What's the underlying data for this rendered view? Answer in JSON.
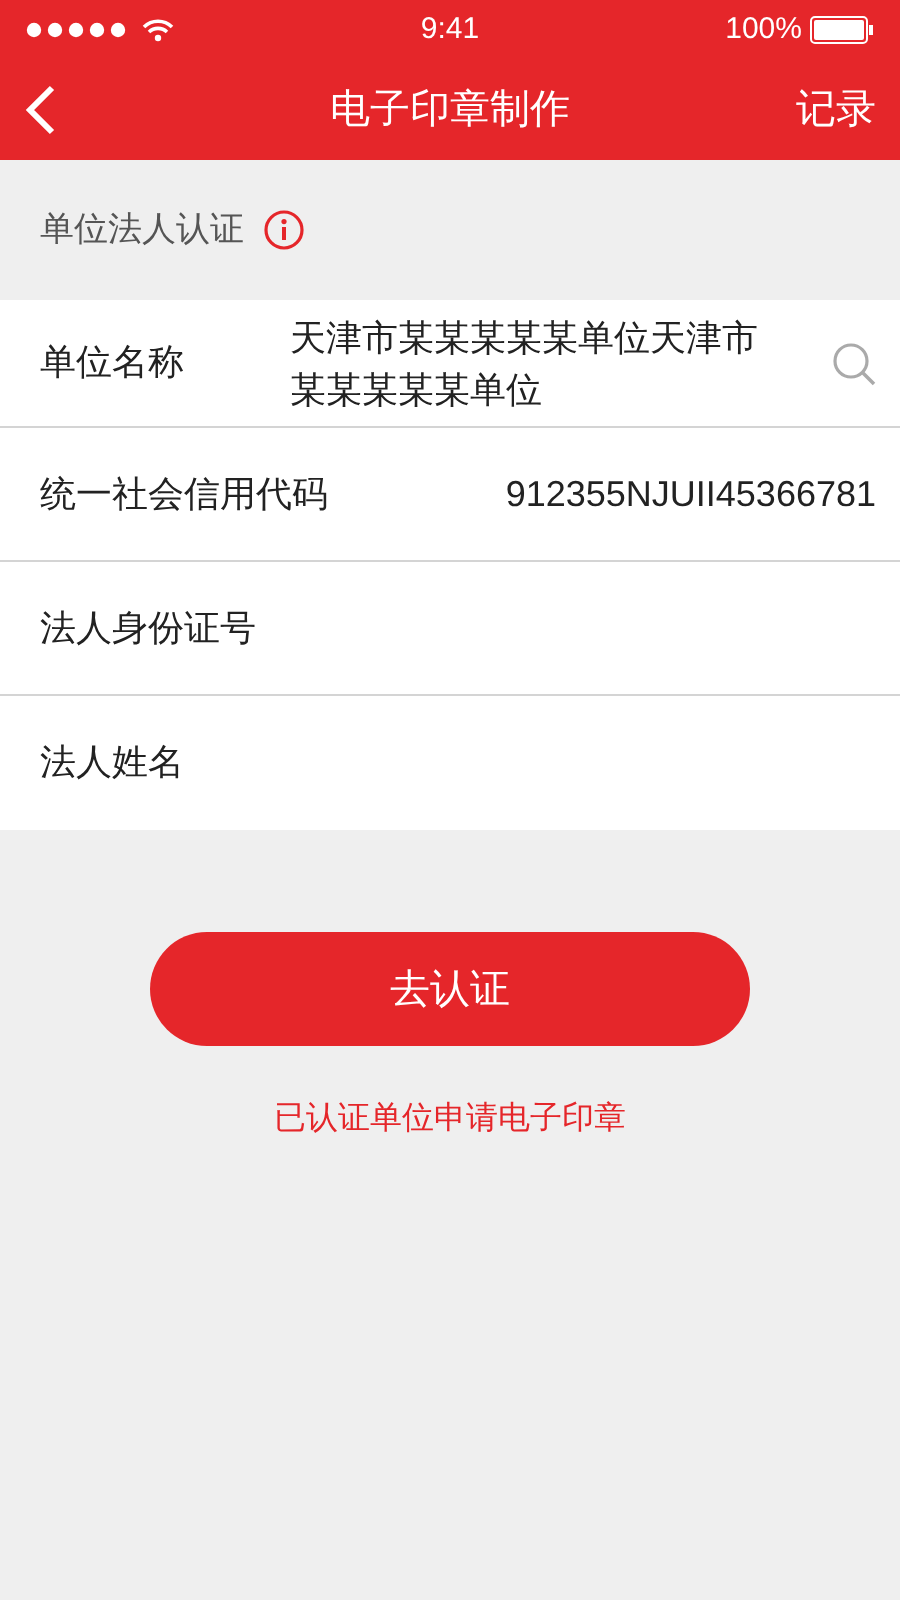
{
  "status_bar": {
    "time": "9:41",
    "battery": "100%"
  },
  "nav": {
    "title": "电子印章制作",
    "action": "记录"
  },
  "section": {
    "title": "单位法人认证"
  },
  "fields": [
    {
      "kind": "search",
      "label": "单位名称",
      "value": "天津市某某某某某单位天津市某某某某某单位"
    },
    {
      "kind": "text",
      "label": "统一社会信用代码",
      "value": "912355NJUII45366781"
    },
    {
      "kind": "text",
      "label": "法人身份证号"
    },
    {
      "kind": "text",
      "label": "法人姓名"
    }
  ],
  "submit": "去认证",
  "link": "已认证单位申请电子印章"
}
